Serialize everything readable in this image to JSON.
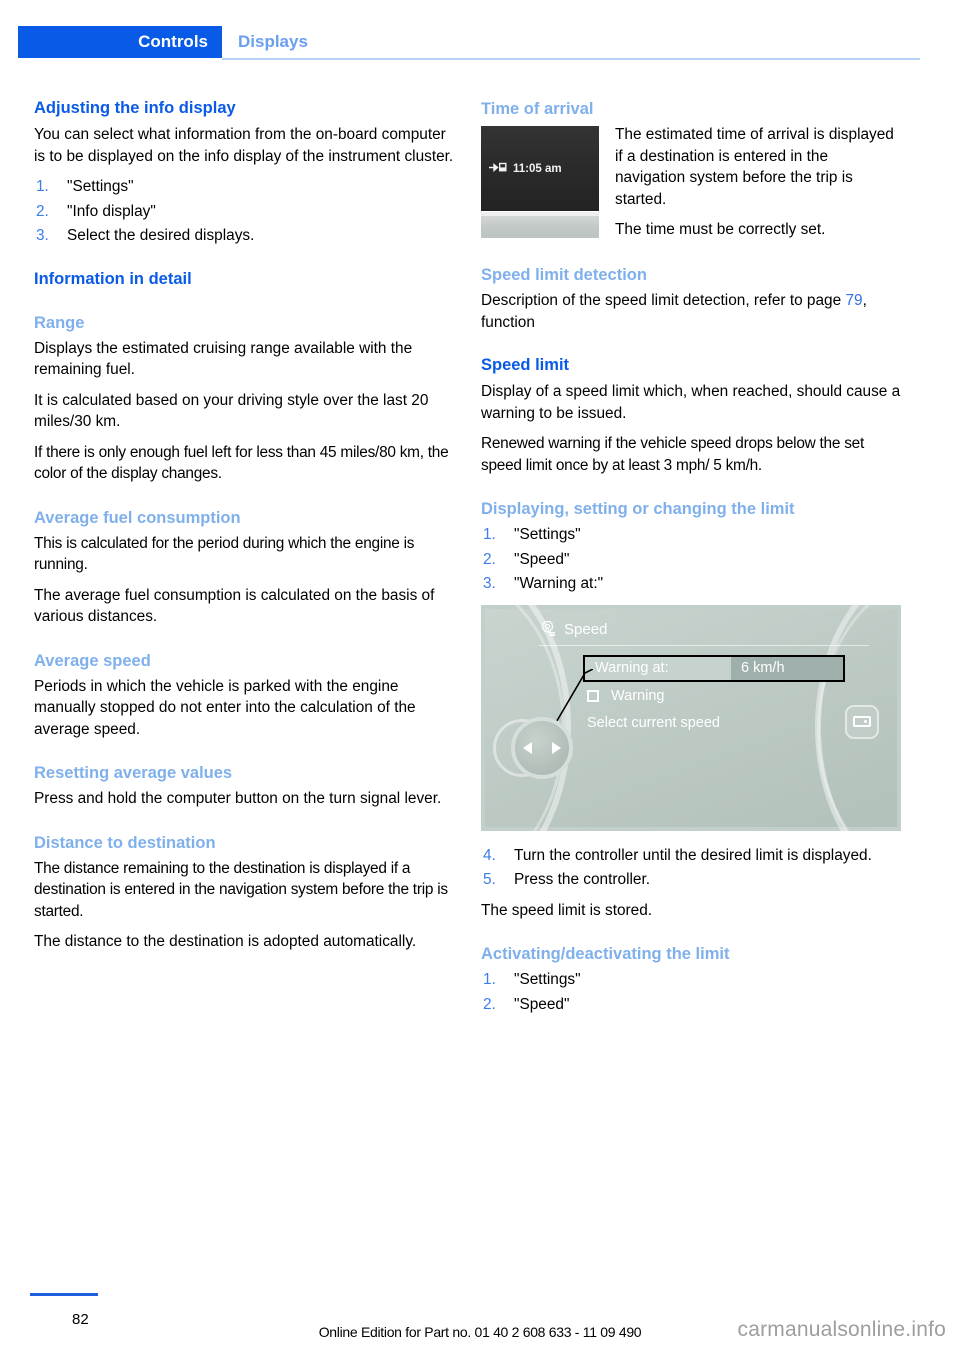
{
  "header": {
    "active_tab": "Controls",
    "inactive_tab": "Displays",
    "accent_color": "#0a5ae8",
    "inactive_color": "#6b9ff0"
  },
  "left_column": {
    "section1": {
      "heading": "Adjusting the info display",
      "paragraph": "You can select what information from the on-board computer is to be displayed on the info display of the instrument cluster.",
      "steps": [
        {
          "num": "1.",
          "text": "\"Settings\""
        },
        {
          "num": "2.",
          "text": "\"Info display\""
        },
        {
          "num": "3.",
          "text": "Select the desired displays."
        }
      ]
    },
    "section2": {
      "heading": "Information in detail"
    },
    "range": {
      "heading": "Range",
      "p1": "Displays the estimated cruising range available with the remaining fuel.",
      "p2": "It is calculated based on your driving style over the last 20 miles/30 km.",
      "p3": "If there is only enough fuel left for less than 45 miles/80 km, the color of the display changes."
    },
    "avg_fuel": {
      "heading": "Average fuel consumption",
      "p1": "This is calculated for the period during which the engine is running.",
      "p2": "The average fuel consumption is calculated on the basis of various distances."
    },
    "avg_speed": {
      "heading": "Average speed",
      "p1": "Periods in which the vehicle is parked with the engine manually stopped do not enter into the calculation of the average speed."
    },
    "reset": {
      "heading": "Resetting average values",
      "p1": "Press and hold the computer button on the turn signal lever."
    },
    "distance": {
      "heading": "Distance to destination",
      "p1": "The distance remaining to the destination is displayed if a destination is entered in the navigation system before the trip is started.",
      "p2": "The distance to the destination is adopted automatically."
    }
  },
  "right_column": {
    "arrival": {
      "heading": "Time of arrival",
      "figure": {
        "time": "11:05 am",
        "icon": "destination-flag-icon"
      },
      "p1": "The estimated time of arrival is displayed if a destination is entered in the navigation system before the trip is started.",
      "p2": "The time must be correctly set."
    },
    "speed_detection": {
      "heading": "Speed limit detection",
      "text_before": "Description of the speed limit detection, refer to page ",
      "page_ref": "79",
      "text_after": ", function"
    },
    "speed_limit": {
      "heading": "Speed limit",
      "p1": "Display of a speed limit which, when reached, should cause a warning to be issued.",
      "p2": "Renewed warning if the vehicle speed drops below the set speed limit once by at least 3 mph/ 5 km/h."
    },
    "displaying": {
      "heading": "Displaying, setting or changing the limit",
      "steps": [
        {
          "num": "1.",
          "text": "\"Settings\""
        },
        {
          "num": "2.",
          "text": "\"Speed\""
        },
        {
          "num": "3.",
          "text": "\"Warning at:\""
        }
      ]
    },
    "idrive_figure": {
      "title": "Speed",
      "title_icon": "gear-icon",
      "row_label": "Warning at:",
      "row_value": "6 km/h",
      "checkbox_label": "Warning",
      "hint": "Select current speed",
      "background_color": "#c3cfca"
    },
    "steps_after": [
      {
        "num": "4.",
        "text": "Turn the controller until the desired limit is displayed."
      },
      {
        "num": "5.",
        "text": "Press the controller."
      }
    ],
    "stored_note": "The speed limit is stored.",
    "activating": {
      "heading": "Activating/deactivating the limit",
      "steps": [
        {
          "num": "1.",
          "text": "\"Settings\""
        },
        {
          "num": "2.",
          "text": "\"Speed\""
        }
      ]
    }
  },
  "footer": {
    "page_number": "82",
    "edition_text": "Online Edition for Part no. 01 40 2 608 633 - 11 09 490",
    "watermark": "carmanualsonline.info"
  }
}
